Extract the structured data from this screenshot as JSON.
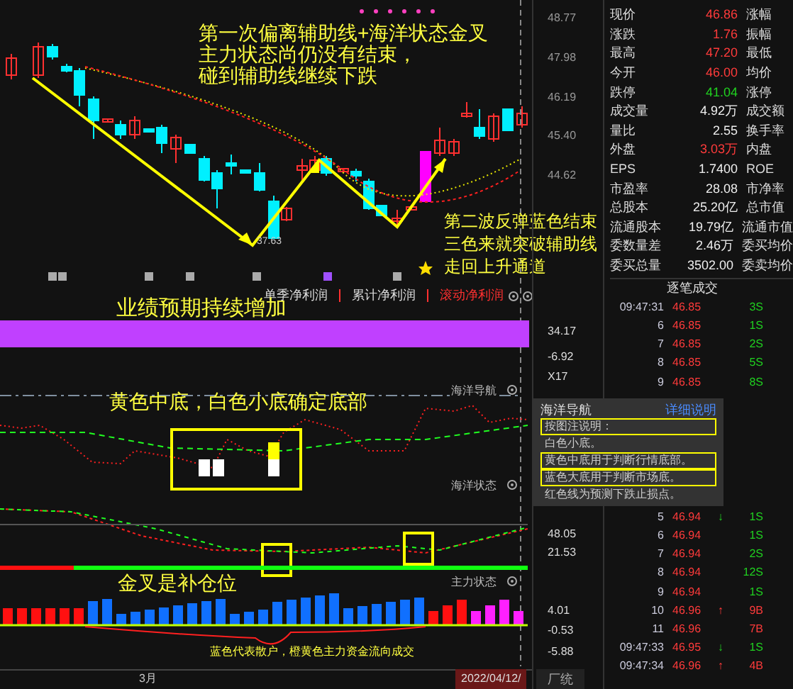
{
  "main_chart": {
    "annotations": [
      "第一次偏离辅助线+海洋状态金叉",
      "主力状态尚仍没有结束，",
      "碰到辅助线继续下跌"
    ],
    "low_label": "37.63",
    "wave_note": [
      "第二波反弹蓝色结束",
      "三色来就突破辅助线",
      "走回上升通道"
    ]
  },
  "indicator_tabs": [
    {
      "label": "单季净利润",
      "selected": false
    },
    {
      "label": "累计净利润",
      "selected": false
    },
    {
      "label": "滚动净利润",
      "selected": true
    }
  ],
  "earnings_note": "业绩预期持续增加",
  "ocean_panel": {
    "title": "海洋导航",
    "note": "黄色中底，白色小底确定底部",
    "state_label": "海洋状态"
  },
  "main_force_panel": {
    "label": "主力状态",
    "note": "金叉是补仓位",
    "legend": "蓝色代表散户，橙黄色主力资金流向成交"
  },
  "time_axis": {
    "month": "3月",
    "cursor_date": "2022/04/12/",
    "tab": "厂统"
  },
  "price_axis": [
    "48.77",
    "47.98",
    "46.19",
    "45.40",
    "44.62"
  ],
  "lower_axis": [
    "34.17",
    "-6.92",
    "X17",
    "48.05",
    "21.53",
    "4.01",
    "-0.53",
    "-5.88"
  ],
  "quote": [
    {
      "label": "现价",
      "value": "46.86",
      "color": "#ff3b3b",
      "label2": "涨幅"
    },
    {
      "label": "涨跌",
      "value": "1.76",
      "color": "#ff3b3b",
      "label2": "振幅"
    },
    {
      "label": "最高",
      "value": "47.20",
      "color": "#ff3b3b",
      "label2": "最低"
    },
    {
      "label": "今开",
      "value": "46.00",
      "color": "#ff3b3b",
      "label2": "均价"
    },
    {
      "label": "跌停",
      "value": "41.04",
      "color": "#20d020",
      "label2": "涨停"
    },
    {
      "label": "成交量",
      "value": "4.92万",
      "color": "#eeeeee",
      "label2": "成交额"
    },
    {
      "label": "量比",
      "value": "2.55",
      "color": "#eeeeee",
      "label2": "换手率"
    },
    {
      "label": "外盘",
      "value": "3.03万",
      "color": "#ff3b3b",
      "label2": "内盘"
    },
    {
      "label": "EPS",
      "value": "1.7400",
      "color": "#eeeeee",
      "label2": "ROE"
    },
    {
      "label": "市盈率",
      "value": "28.08",
      "color": "#eeeeee",
      "label2": "市净率"
    },
    {
      "label": "总股本",
      "value": "25.20亿",
      "color": "#eeeeee",
      "label2": "总市值"
    },
    {
      "label": "流通股本",
      "value": "19.79亿",
      "color": "#eeeeee",
      "label2": "流通市值"
    },
    {
      "label": "委数量差",
      "value": "2.46万",
      "color": "#eeeeee",
      "label2": "委买均价"
    },
    {
      "label": "委买总量",
      "value": "3502.00",
      "color": "#eeeeee",
      "label2": "委卖均价"
    }
  ],
  "trades_title": "逐笔成交",
  "trades_top": [
    {
      "time": "09:47:31",
      "price": "46.85",
      "volume": "3S",
      "buy": false
    },
    {
      "time": "6",
      "price": "46.85",
      "volume": "1S",
      "buy": false
    },
    {
      "time": "7",
      "price": "46.85",
      "volume": "2S",
      "buy": false
    },
    {
      "time": "8",
      "price": "46.85",
      "volume": "5S",
      "buy": false
    },
    {
      "time": "9",
      "price": "46.85",
      "volume": "8S",
      "buy": false
    }
  ],
  "trades_bottom": [
    {
      "time": "5",
      "price": "46.94",
      "arrow": {
        "glyph": "↓",
        "rising": false
      },
      "volume": "1S",
      "buy": false
    },
    {
      "time": "6",
      "price": "46.94",
      "volume": "1S",
      "buy": false
    },
    {
      "time": "7",
      "price": "46.94",
      "volume": "2S",
      "buy": false
    },
    {
      "time": "8",
      "price": "46.94",
      "volume": "12S",
      "buy": false
    },
    {
      "time": "9",
      "price": "46.94",
      "volume": "1S",
      "buy": false
    },
    {
      "time": "10",
      "price": "46.96",
      "arrow": {
        "glyph": "↑",
        "rising": true
      },
      "volume": "9B",
      "buy": true
    },
    {
      "time": "11",
      "price": "46.96",
      "volume": "7B",
      "buy": true
    },
    {
      "time": "09:47:33",
      "price": "46.95",
      "arrow": {
        "glyph": "↓",
        "rising": false
      },
      "volume": "1S",
      "buy": false
    },
    {
      "time": "09:47:34",
      "price": "46.96",
      "arrow": {
        "glyph": "↑",
        "rising": true
      },
      "volume": "4B",
      "buy": true
    }
  ],
  "popup": {
    "title": "海洋导航",
    "link": "详细说明",
    "lines": [
      {
        "text": "按图注说明：",
        "boxed": true
      },
      {
        "text": "白色小底。",
        "boxed": false
      },
      {
        "text": "黄色中底用于判断行情底部。",
        "boxed": true
      },
      {
        "text": "蓝色大底用于判断市场底。",
        "boxed": true
      },
      {
        "text": "红色线为预测下跌止损点。",
        "boxed": false
      }
    ]
  }
}
